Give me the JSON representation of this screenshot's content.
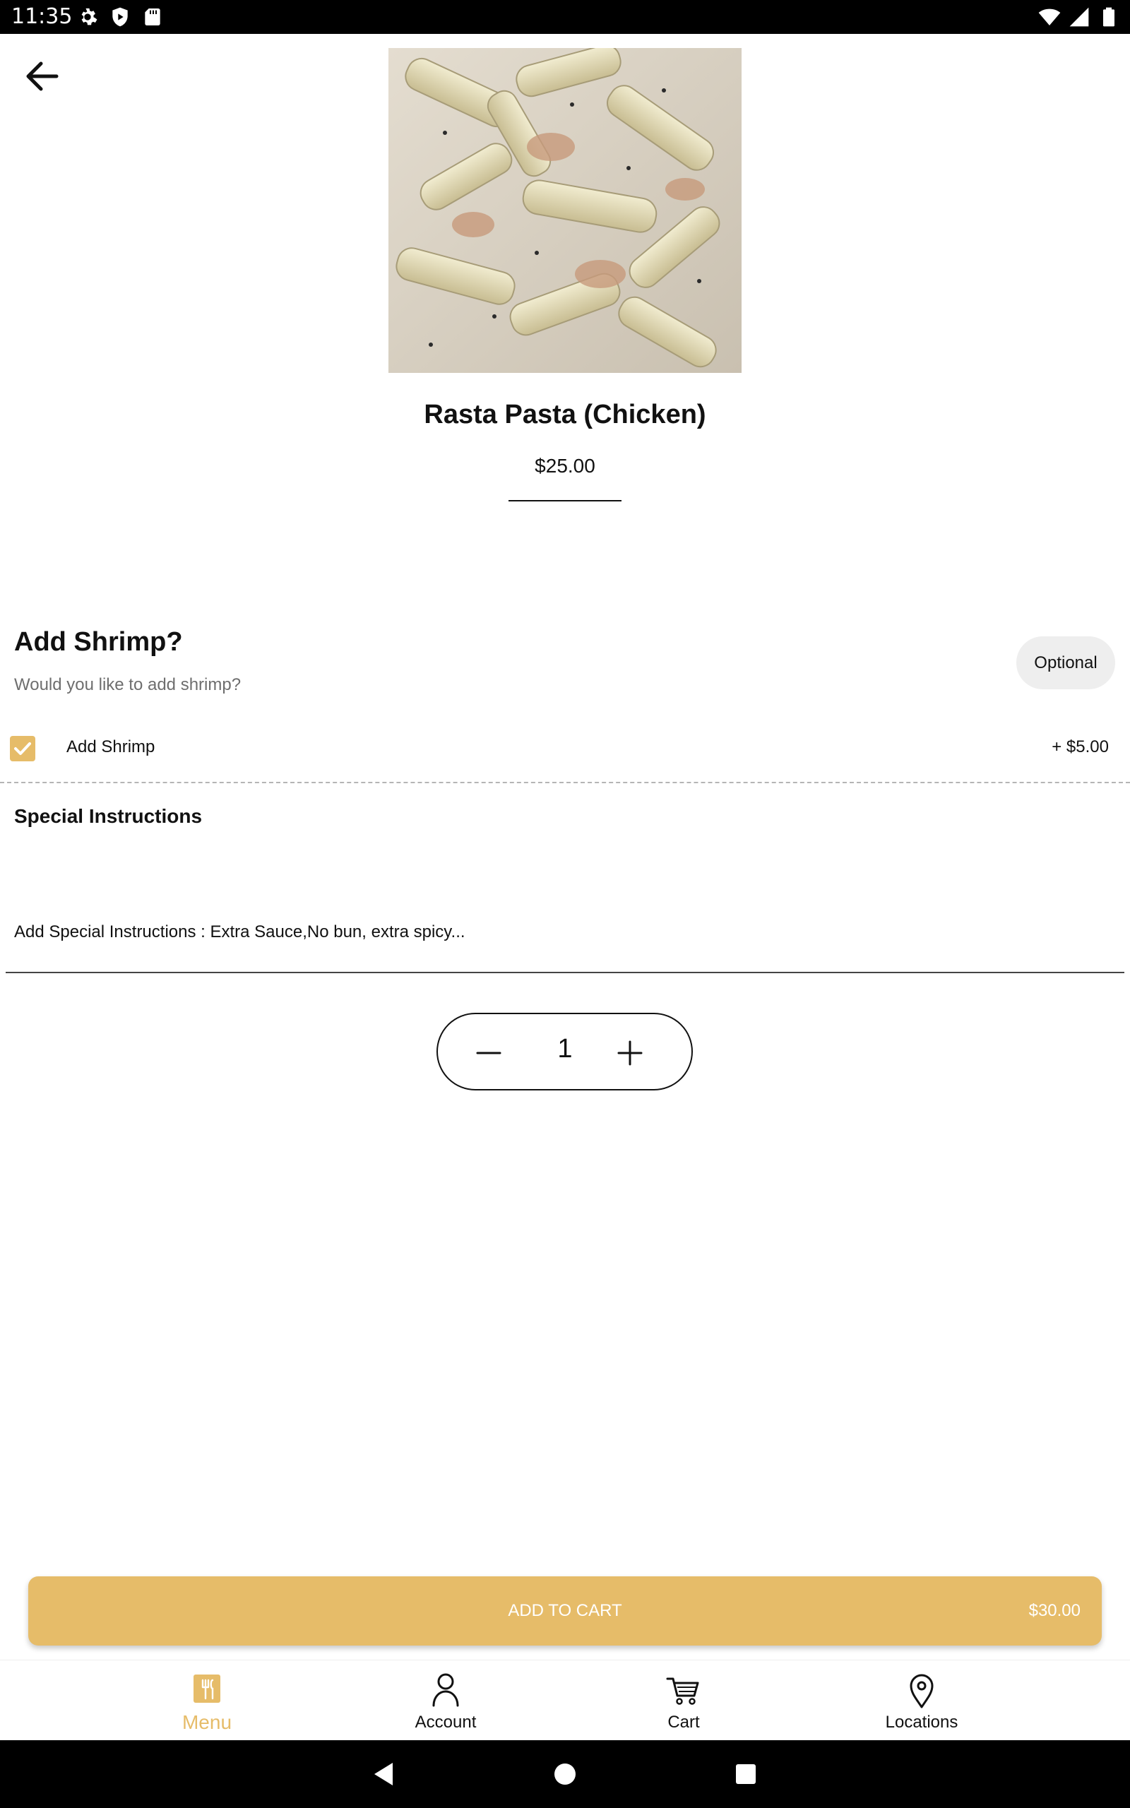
{
  "status_bar": {
    "time": "11:35",
    "left_icons": [
      "gear-icon",
      "play-protect-icon",
      "sd-card-icon"
    ],
    "right_icons": [
      "wifi-icon",
      "signal-icon",
      "battery-icon"
    ]
  },
  "header": {
    "back_icon": "arrow-left-icon"
  },
  "product": {
    "name": "Rasta Pasta (Chicken)",
    "price": "$25.00",
    "image_alt": "Rasta Pasta (Chicken)"
  },
  "modifier_group": {
    "title": "Add Shrimp?",
    "subtitle": "Would you like to add shrimp?",
    "badge": "Optional",
    "options": [
      {
        "label": "Add Shrimp",
        "price": "+ $5.00",
        "checked": true
      }
    ]
  },
  "special_instructions": {
    "title": "Special Instructions",
    "placeholder": "Add Special Instructions : Extra Sauce,No bun, extra spicy...",
    "value": ""
  },
  "quantity": {
    "value": "1"
  },
  "add_to_cart": {
    "label": "ADD TO CART",
    "total": "$30.00"
  },
  "bottom_nav": {
    "items": [
      {
        "label": "Menu",
        "icon": "menu-icon",
        "active": true
      },
      {
        "label": "Account",
        "icon": "account-icon",
        "active": false
      },
      {
        "label": "Cart",
        "icon": "cart-icon",
        "active": false
      },
      {
        "label": "Locations",
        "icon": "location-pin-icon",
        "active": false
      }
    ]
  },
  "colors": {
    "accent": "#e6bc69",
    "text": "#111111",
    "muted": "#6e6e6e",
    "badge_bg": "#eeeeee",
    "system_bar": "#000000"
  }
}
